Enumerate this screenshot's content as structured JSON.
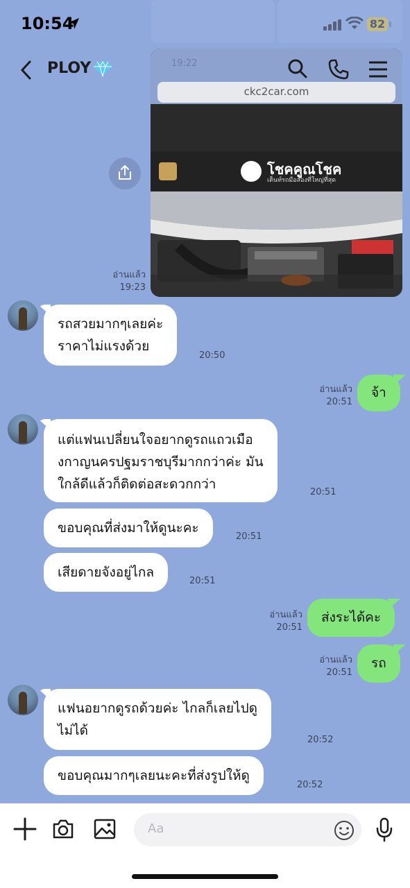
{
  "status_bar": {
    "time": "10:54",
    "battery": "82"
  },
  "header": {
    "title": "PLOY"
  },
  "shared_image": {
    "url_text": "ckc2car.com",
    "site_name": "โชคคูณโชค",
    "site_tagline": "เต็นท์รถมือสองที่ใหญ่ที่สุด",
    "overlay_time": "19:22"
  },
  "messages": [
    {
      "dir": "out",
      "type": "image",
      "read": "อ่านแล้ว",
      "time": "19:23"
    },
    {
      "dir": "in",
      "text": [
        "รถสวยมากๆเลยค่ะ",
        "ราคาไม่แรงด้วย"
      ],
      "time": "20:50"
    },
    {
      "dir": "out",
      "text": [
        "จ้า"
      ],
      "read": "อ่านแล้ว",
      "time": "20:51"
    },
    {
      "dir": "in",
      "text": [
        "แต่แฟนเปลี่ยนใจอยากดูรถแถวเมือ",
        "งกาญนครปฐมราชบุรีมากกว่าค่ะ มัน",
        "ใกล้ดีแล้วก็ติดต่อสะดวกกว่า"
      ],
      "time": "20:51"
    },
    {
      "dir": "in",
      "text": [
        "ขอบคุณที่ส่งมาให้ดูนะคะ"
      ],
      "time": "20:51"
    },
    {
      "dir": "in",
      "text": [
        "เสียดายจังอยู่ไกล"
      ],
      "time": "20:51"
    },
    {
      "dir": "out",
      "text": [
        "ส่งระได้คะ"
      ],
      "read": "อ่านแล้ว",
      "time": "20:51"
    },
    {
      "dir": "out",
      "text": [
        "รถ"
      ],
      "read": "อ่านแล้ว",
      "time": "20:51"
    },
    {
      "dir": "in",
      "text": [
        "แฟนอยากดูรถด้วยค่ะ ไกลก็เลยไปดู",
        "ไม่ได้"
      ],
      "time": "20:52"
    },
    {
      "dir": "in",
      "text": [
        "ขอบคุณมากๆเลยนะคะที่ส่งรูปให้ดู"
      ],
      "time": "20:52"
    }
  ],
  "input": {
    "placeholder": "Aa"
  },
  "colors": {
    "background": "#8fa9dd",
    "outgoing_bubble": "#84e57c",
    "incoming_bubble": "#ffffff"
  }
}
